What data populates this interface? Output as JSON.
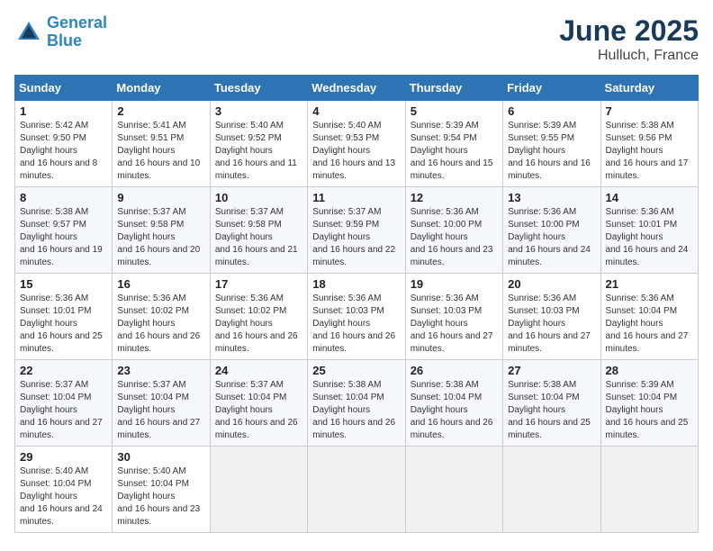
{
  "logo": {
    "line1": "General",
    "line2": "Blue"
  },
  "title": "June 2025",
  "subtitle": "Hulluch, France",
  "weekdays": [
    "Sunday",
    "Monday",
    "Tuesday",
    "Wednesday",
    "Thursday",
    "Friday",
    "Saturday"
  ],
  "weeks": [
    [
      {
        "day": "1",
        "sr": "5:42 AM",
        "ss": "9:50 PM",
        "dl": "16 hours and 8 minutes."
      },
      {
        "day": "2",
        "sr": "5:41 AM",
        "ss": "9:51 PM",
        "dl": "16 hours and 10 minutes."
      },
      {
        "day": "3",
        "sr": "5:40 AM",
        "ss": "9:52 PM",
        "dl": "16 hours and 11 minutes."
      },
      {
        "day": "4",
        "sr": "5:40 AM",
        "ss": "9:53 PM",
        "dl": "16 hours and 13 minutes."
      },
      {
        "day": "5",
        "sr": "5:39 AM",
        "ss": "9:54 PM",
        "dl": "16 hours and 15 minutes."
      },
      {
        "day": "6",
        "sr": "5:39 AM",
        "ss": "9:55 PM",
        "dl": "16 hours and 16 minutes."
      },
      {
        "day": "7",
        "sr": "5:38 AM",
        "ss": "9:56 PM",
        "dl": "16 hours and 17 minutes."
      }
    ],
    [
      {
        "day": "8",
        "sr": "5:38 AM",
        "ss": "9:57 PM",
        "dl": "16 hours and 19 minutes."
      },
      {
        "day": "9",
        "sr": "5:37 AM",
        "ss": "9:58 PM",
        "dl": "16 hours and 20 minutes."
      },
      {
        "day": "10",
        "sr": "5:37 AM",
        "ss": "9:58 PM",
        "dl": "16 hours and 21 minutes."
      },
      {
        "day": "11",
        "sr": "5:37 AM",
        "ss": "9:59 PM",
        "dl": "16 hours and 22 minutes."
      },
      {
        "day": "12",
        "sr": "5:36 AM",
        "ss": "10:00 PM",
        "dl": "16 hours and 23 minutes."
      },
      {
        "day": "13",
        "sr": "5:36 AM",
        "ss": "10:00 PM",
        "dl": "16 hours and 24 minutes."
      },
      {
        "day": "14",
        "sr": "5:36 AM",
        "ss": "10:01 PM",
        "dl": "16 hours and 24 minutes."
      }
    ],
    [
      {
        "day": "15",
        "sr": "5:36 AM",
        "ss": "10:01 PM",
        "dl": "16 hours and 25 minutes."
      },
      {
        "day": "16",
        "sr": "5:36 AM",
        "ss": "10:02 PM",
        "dl": "16 hours and 26 minutes."
      },
      {
        "day": "17",
        "sr": "5:36 AM",
        "ss": "10:02 PM",
        "dl": "16 hours and 26 minutes."
      },
      {
        "day": "18",
        "sr": "5:36 AM",
        "ss": "10:03 PM",
        "dl": "16 hours and 26 minutes."
      },
      {
        "day": "19",
        "sr": "5:36 AM",
        "ss": "10:03 PM",
        "dl": "16 hours and 27 minutes."
      },
      {
        "day": "20",
        "sr": "5:36 AM",
        "ss": "10:03 PM",
        "dl": "16 hours and 27 minutes."
      },
      {
        "day": "21",
        "sr": "5:36 AM",
        "ss": "10:04 PM",
        "dl": "16 hours and 27 minutes."
      }
    ],
    [
      {
        "day": "22",
        "sr": "5:37 AM",
        "ss": "10:04 PM",
        "dl": "16 hours and 27 minutes."
      },
      {
        "day": "23",
        "sr": "5:37 AM",
        "ss": "10:04 PM",
        "dl": "16 hours and 27 minutes."
      },
      {
        "day": "24",
        "sr": "5:37 AM",
        "ss": "10:04 PM",
        "dl": "16 hours and 26 minutes."
      },
      {
        "day": "25",
        "sr": "5:38 AM",
        "ss": "10:04 PM",
        "dl": "16 hours and 26 minutes."
      },
      {
        "day": "26",
        "sr": "5:38 AM",
        "ss": "10:04 PM",
        "dl": "16 hours and 26 minutes."
      },
      {
        "day": "27",
        "sr": "5:38 AM",
        "ss": "10:04 PM",
        "dl": "16 hours and 25 minutes."
      },
      {
        "day": "28",
        "sr": "5:39 AM",
        "ss": "10:04 PM",
        "dl": "16 hours and 25 minutes."
      }
    ],
    [
      {
        "day": "29",
        "sr": "5:40 AM",
        "ss": "10:04 PM",
        "dl": "16 hours and 24 minutes."
      },
      {
        "day": "30",
        "sr": "5:40 AM",
        "ss": "10:04 PM",
        "dl": "16 hours and 23 minutes."
      },
      null,
      null,
      null,
      null,
      null
    ]
  ]
}
